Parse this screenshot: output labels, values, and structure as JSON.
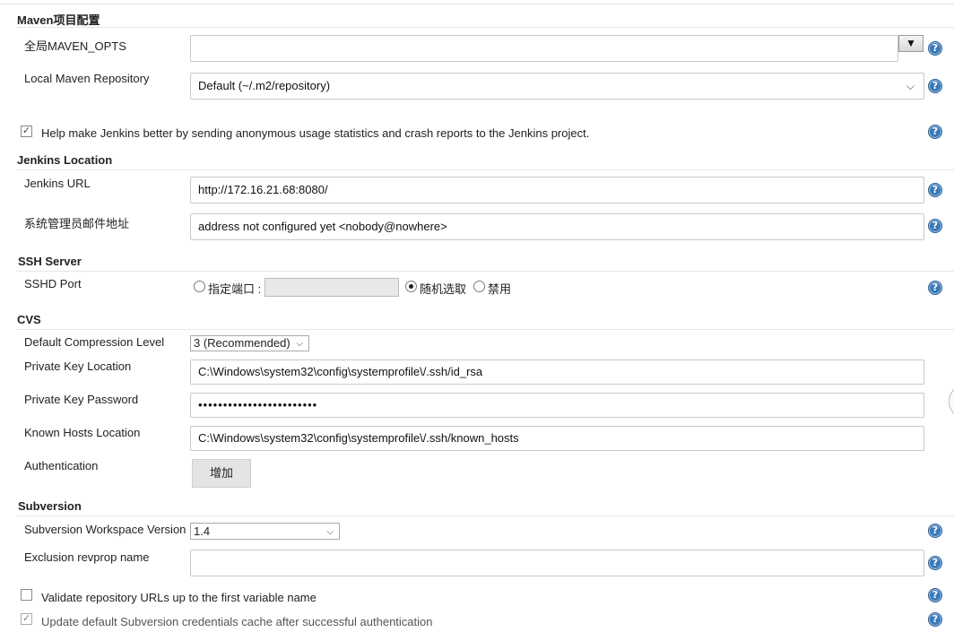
{
  "maven": {
    "section_title": "Maven项目配置",
    "global_opts_label": "全局MAVEN_OPTS",
    "global_opts_value": "",
    "expand_icon": "▼",
    "local_repo_label": "Local Maven Repository",
    "local_repo_value": "Default (~/.m2/repository)"
  },
  "usage_stats": {
    "checked": true,
    "label": "Help make Jenkins better by sending anonymous usage statistics and crash reports to the Jenkins project."
  },
  "location": {
    "section_title": "Jenkins Location",
    "url_label": "Jenkins URL",
    "url_value": "http://172.16.21.68:8080/",
    "email_label": "系统管理员邮件地址",
    "email_value": "address not configured yet <nobody@nowhere>"
  },
  "ssh": {
    "section_title": "SSH Server",
    "port_label": "SSHD Port",
    "option_fixed": "指定端口 :",
    "fixed_port_value": "",
    "option_random": "随机选取",
    "option_disable": "禁用",
    "selected": "random"
  },
  "cvs": {
    "section_title": "CVS",
    "compression_label": "Default Compression Level",
    "compression_value": "3 (Recommended)",
    "key_location_label": "Private Key Location",
    "key_location_value": "C:\\Windows\\system32\\config\\systemprofile\\/.ssh/id_rsa",
    "key_password_label": "Private Key Password",
    "key_password_mask": "••••••••••••••••••••••••",
    "known_hosts_label": "Known Hosts Location",
    "known_hosts_value": "C:\\Windows\\system32\\config\\systemprofile\\/.ssh/known_hosts",
    "auth_label": "Authentication",
    "add_button": "增加"
  },
  "subversion": {
    "section_title": "Subversion",
    "workspace_label": "Subversion Workspace Version",
    "workspace_value": "1.4",
    "exclusion_label": "Exclusion revprop name",
    "exclusion_value": "",
    "validate_checked": false,
    "validate_label": "Validate repository URLs up to the first variable name",
    "update_checked": true,
    "update_label": "Update default Subversion credentials cache after successful authentication"
  },
  "help_glyph": "?",
  "check_glyph": "✓"
}
